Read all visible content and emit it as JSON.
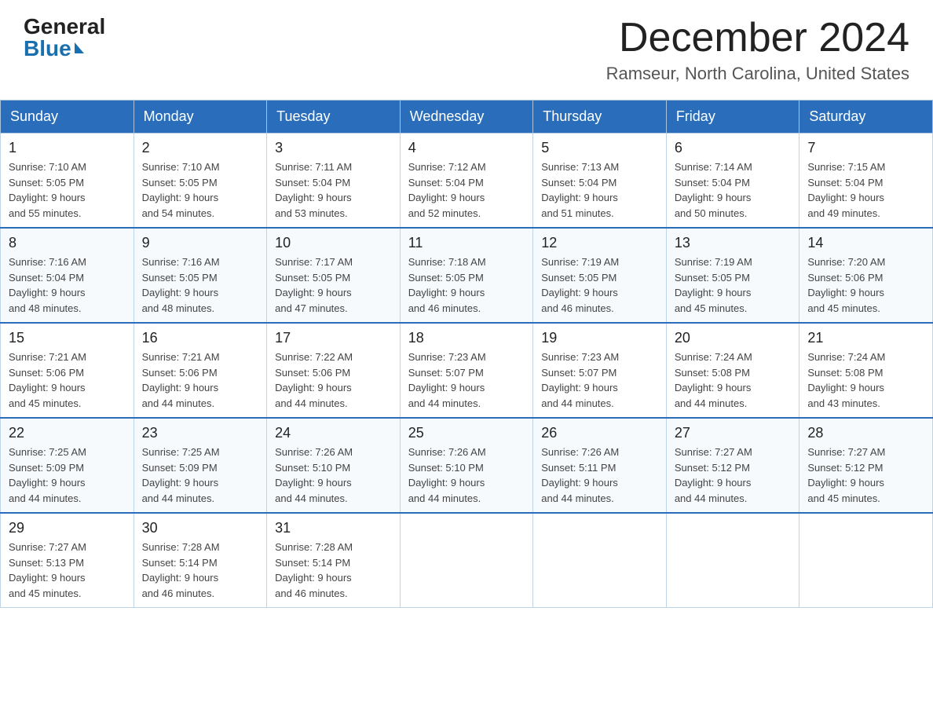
{
  "header": {
    "logo": {
      "general": "General",
      "blue": "Blue"
    },
    "month": "December 2024",
    "location": "Ramseur, North Carolina, United States"
  },
  "days_of_week": [
    "Sunday",
    "Monday",
    "Tuesday",
    "Wednesday",
    "Thursday",
    "Friday",
    "Saturday"
  ],
  "weeks": [
    [
      {
        "day": "1",
        "sunrise": "7:10 AM",
        "sunset": "5:05 PM",
        "daylight": "9 hours and 55 minutes."
      },
      {
        "day": "2",
        "sunrise": "7:10 AM",
        "sunset": "5:05 PM",
        "daylight": "9 hours and 54 minutes."
      },
      {
        "day": "3",
        "sunrise": "7:11 AM",
        "sunset": "5:04 PM",
        "daylight": "9 hours and 53 minutes."
      },
      {
        "day": "4",
        "sunrise": "7:12 AM",
        "sunset": "5:04 PM",
        "daylight": "9 hours and 52 minutes."
      },
      {
        "day": "5",
        "sunrise": "7:13 AM",
        "sunset": "5:04 PM",
        "daylight": "9 hours and 51 minutes."
      },
      {
        "day": "6",
        "sunrise": "7:14 AM",
        "sunset": "5:04 PM",
        "daylight": "9 hours and 50 minutes."
      },
      {
        "day": "7",
        "sunrise": "7:15 AM",
        "sunset": "5:04 PM",
        "daylight": "9 hours and 49 minutes."
      }
    ],
    [
      {
        "day": "8",
        "sunrise": "7:16 AM",
        "sunset": "5:04 PM",
        "daylight": "9 hours and 48 minutes."
      },
      {
        "day": "9",
        "sunrise": "7:16 AM",
        "sunset": "5:05 PM",
        "daylight": "9 hours and 48 minutes."
      },
      {
        "day": "10",
        "sunrise": "7:17 AM",
        "sunset": "5:05 PM",
        "daylight": "9 hours and 47 minutes."
      },
      {
        "day": "11",
        "sunrise": "7:18 AM",
        "sunset": "5:05 PM",
        "daylight": "9 hours and 46 minutes."
      },
      {
        "day": "12",
        "sunrise": "7:19 AM",
        "sunset": "5:05 PM",
        "daylight": "9 hours and 46 minutes."
      },
      {
        "day": "13",
        "sunrise": "7:19 AM",
        "sunset": "5:05 PM",
        "daylight": "9 hours and 45 minutes."
      },
      {
        "day": "14",
        "sunrise": "7:20 AM",
        "sunset": "5:06 PM",
        "daylight": "9 hours and 45 minutes."
      }
    ],
    [
      {
        "day": "15",
        "sunrise": "7:21 AM",
        "sunset": "5:06 PM",
        "daylight": "9 hours and 45 minutes."
      },
      {
        "day": "16",
        "sunrise": "7:21 AM",
        "sunset": "5:06 PM",
        "daylight": "9 hours and 44 minutes."
      },
      {
        "day": "17",
        "sunrise": "7:22 AM",
        "sunset": "5:06 PM",
        "daylight": "9 hours and 44 minutes."
      },
      {
        "day": "18",
        "sunrise": "7:23 AM",
        "sunset": "5:07 PM",
        "daylight": "9 hours and 44 minutes."
      },
      {
        "day": "19",
        "sunrise": "7:23 AM",
        "sunset": "5:07 PM",
        "daylight": "9 hours and 44 minutes."
      },
      {
        "day": "20",
        "sunrise": "7:24 AM",
        "sunset": "5:08 PM",
        "daylight": "9 hours and 44 minutes."
      },
      {
        "day": "21",
        "sunrise": "7:24 AM",
        "sunset": "5:08 PM",
        "daylight": "9 hours and 43 minutes."
      }
    ],
    [
      {
        "day": "22",
        "sunrise": "7:25 AM",
        "sunset": "5:09 PM",
        "daylight": "9 hours and 44 minutes."
      },
      {
        "day": "23",
        "sunrise": "7:25 AM",
        "sunset": "5:09 PM",
        "daylight": "9 hours and 44 minutes."
      },
      {
        "day": "24",
        "sunrise": "7:26 AM",
        "sunset": "5:10 PM",
        "daylight": "9 hours and 44 minutes."
      },
      {
        "day": "25",
        "sunrise": "7:26 AM",
        "sunset": "5:10 PM",
        "daylight": "9 hours and 44 minutes."
      },
      {
        "day": "26",
        "sunrise": "7:26 AM",
        "sunset": "5:11 PM",
        "daylight": "9 hours and 44 minutes."
      },
      {
        "day": "27",
        "sunrise": "7:27 AM",
        "sunset": "5:12 PM",
        "daylight": "9 hours and 44 minutes."
      },
      {
        "day": "28",
        "sunrise": "7:27 AM",
        "sunset": "5:12 PM",
        "daylight": "9 hours and 45 minutes."
      }
    ],
    [
      {
        "day": "29",
        "sunrise": "7:27 AM",
        "sunset": "5:13 PM",
        "daylight": "9 hours and 45 minutes."
      },
      {
        "day": "30",
        "sunrise": "7:28 AM",
        "sunset": "5:14 PM",
        "daylight": "9 hours and 46 minutes."
      },
      {
        "day": "31",
        "sunrise": "7:28 AM",
        "sunset": "5:14 PM",
        "daylight": "9 hours and 46 minutes."
      },
      null,
      null,
      null,
      null
    ]
  ],
  "labels": {
    "sunrise": "Sunrise:",
    "sunset": "Sunset:",
    "daylight": "Daylight:"
  }
}
